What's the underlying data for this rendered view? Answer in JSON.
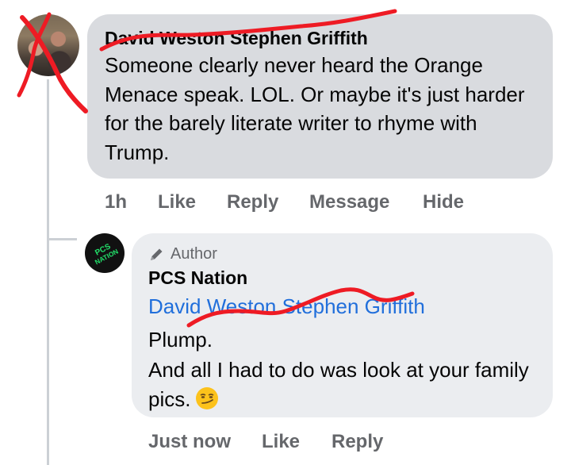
{
  "comment": {
    "author": "David Weston Stephen Griffith",
    "text": "Someone clearly never heard the Orange Menace speak. LOL. Or maybe it's just harder for the barely literate writer to rhyme with Trump.",
    "time": "1h",
    "actions": {
      "like": "Like",
      "reply": "Reply",
      "message": "Message",
      "hide": "Hide"
    }
  },
  "reply": {
    "badge_label": "Author",
    "author": "PCS Nation",
    "avatar_text_top": "PCS",
    "avatar_text_bottom": "NATION",
    "mention": "David Weston Stephen Griffith",
    "text_line1": "Plump.",
    "text_line2": "And all I had to do was look at your family pics.",
    "time": "Just now",
    "actions": {
      "like": "Like",
      "reply": "Reply"
    }
  },
  "colors": {
    "bubble_comment": "#d9dbdf",
    "bubble_reply": "#ebedf0",
    "mention_link": "#216fdb",
    "meta_gray": "#65676b",
    "red_scribble": "#ee1b24",
    "logo_green": "#22e06a"
  },
  "icons": {
    "author_badge": "pencil-icon",
    "reaction_emoji": "smirking-face-emoji-icon"
  }
}
